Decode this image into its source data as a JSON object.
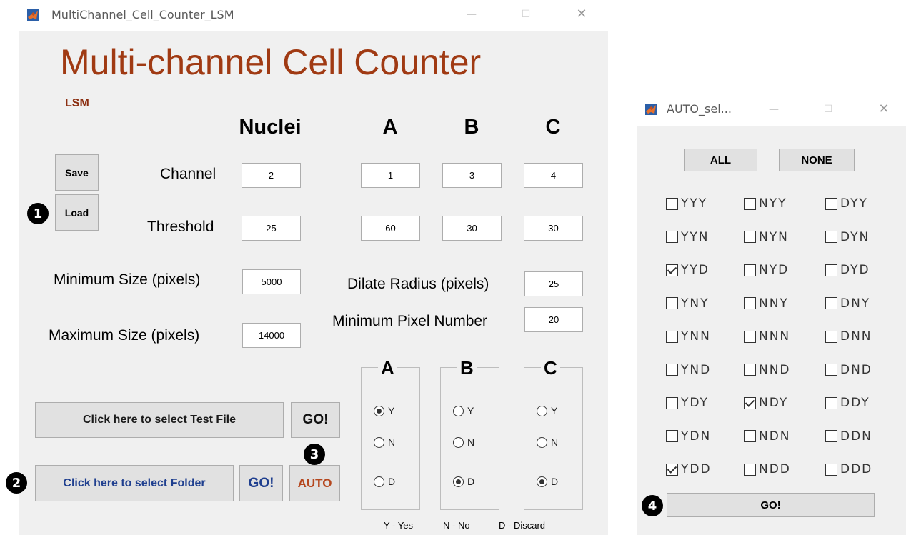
{
  "main_window": {
    "title": "MultiChannel_Cell_Counter_LSM",
    "controls": {
      "minimize": "—",
      "maximize": "☐",
      "close": "✕"
    },
    "app_title": "Multi-channel Cell Counter",
    "subtitle": "LSM",
    "column_headers": {
      "nuclei": "Nuclei",
      "a": "A",
      "b": "B",
      "c": "C"
    },
    "save_label": "Save",
    "load_label": "Load",
    "channel_label": "Channel",
    "threshold_label": "Threshold",
    "channel_values": {
      "nuclei": "2",
      "a": "1",
      "b": "3",
      "c": "4"
    },
    "threshold_values": {
      "nuclei": "25",
      "a": "60",
      "b": "30",
      "c": "30"
    },
    "min_size_label": "Minimum Size (pixels)",
    "min_size_value": "5000",
    "max_size_label": "Maximum Size (pixels)",
    "max_size_value": "14000",
    "dilate_label": "Dilate Radius (pixels)",
    "dilate_value": "25",
    "min_pixel_label": "Minimum Pixel Number",
    "min_pixel_value": "20",
    "test_file_button": "Click here to select Test File",
    "test_go": "GO!",
    "folder_button": "Click here to select Folder",
    "folder_go": "GO!",
    "auto_button": "AUTO",
    "groups": [
      {
        "title": "A",
        "options": [
          "Y",
          "N",
          "D"
        ],
        "selected": "Y"
      },
      {
        "title": "B",
        "options": [
          "Y",
          "N",
          "D"
        ],
        "selected": "D"
      },
      {
        "title": "C",
        "options": [
          "Y",
          "N",
          "D"
        ],
        "selected": "D"
      }
    ],
    "legend": {
      "yes": "Y - Yes",
      "no": "N - No",
      "discard": "D - Discard"
    }
  },
  "auto_window": {
    "title": "AUTO_sel...",
    "controls": {
      "minimize": "—",
      "maximize": "☐",
      "close": "✕"
    },
    "all_button": "ALL",
    "none_button": "NONE",
    "checkboxes": [
      [
        {
          "label": "YYY",
          "checked": false
        },
        {
          "label": "NYY",
          "checked": false
        },
        {
          "label": "DYY",
          "checked": false
        }
      ],
      [
        {
          "label": "YYN",
          "checked": false
        },
        {
          "label": "NYN",
          "checked": false
        },
        {
          "label": "DYN",
          "checked": false
        }
      ],
      [
        {
          "label": "YYD",
          "checked": true
        },
        {
          "label": "NYD",
          "checked": false
        },
        {
          "label": "DYD",
          "checked": false
        }
      ],
      [
        {
          "label": "YNY",
          "checked": false
        },
        {
          "label": "NNY",
          "checked": false
        },
        {
          "label": "DNY",
          "checked": false
        }
      ],
      [
        {
          "label": "YNN",
          "checked": false
        },
        {
          "label": "NNN",
          "checked": false
        },
        {
          "label": "DNN",
          "checked": false
        }
      ],
      [
        {
          "label": "YND",
          "checked": false
        },
        {
          "label": "NND",
          "checked": false
        },
        {
          "label": "DND",
          "checked": false
        }
      ],
      [
        {
          "label": "YDY",
          "checked": false
        },
        {
          "label": "NDY",
          "checked": true
        },
        {
          "label": "DDY",
          "checked": false
        }
      ],
      [
        {
          "label": "YDN",
          "checked": false
        },
        {
          "label": "NDN",
          "checked": false
        },
        {
          "label": "DDN",
          "checked": false
        }
      ],
      [
        {
          "label": "YDD",
          "checked": true
        },
        {
          "label": "NDD",
          "checked": false
        },
        {
          "label": "DDD",
          "checked": false
        }
      ]
    ],
    "go_button": "GO!"
  },
  "step_badges": [
    "1",
    "2",
    "3",
    "4"
  ],
  "colors": {
    "app_title": "#a03a13",
    "subtitle": "#8b2e10",
    "folder_text": "#1f3f8f",
    "auto_text": "#b5471e",
    "panel_bg": "#f0f0f0"
  }
}
